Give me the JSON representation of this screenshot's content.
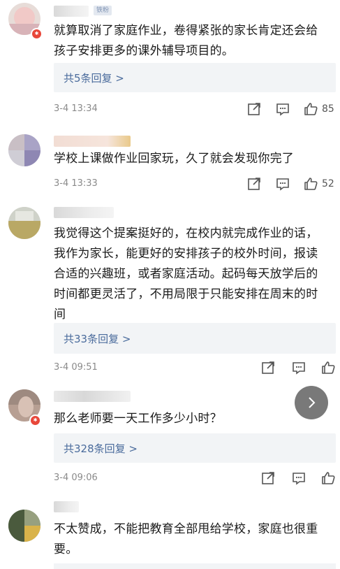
{
  "comments": [
    {
      "badge": "铁粉",
      "text": "就算取消了家庭作业，卷得紧张的家长肯定还会给孩子安排更多的课外辅导项目的。",
      "replies": "共5条回复 >",
      "time": "3-4 13:34",
      "likes": "85"
    },
    {
      "text": "学校上课做作业回家玩，久了就会发现你完了",
      "time": "3-4 13:33",
      "likes": "52"
    },
    {
      "text": "我觉得这个提案挺好的，在校内就完成作业的话，我作为家长，能更好的安排孩子的校外时间，报读合适的兴趣班，或者家庭活动。起码每天放学后的时间都更灵活了，不用局限于只能安排在周末的时间",
      "replies": "共33条回复 >",
      "time": "3-4 09:51"
    },
    {
      "text": "那么老师要一天工作多少小时？",
      "replies": "共328条回复 >",
      "time": "3-4 09:06"
    },
    {
      "text": "不太赞成，不能把教育全部甩给学校，家庭也很重要。"
    }
  ],
  "icons": {
    "share": "share-icon",
    "comment": "comment-icon",
    "like": "thumbs-up-icon",
    "next": "chevron-right-icon"
  },
  "colors": {
    "reply_link": "#4a6b9c",
    "reply_bg": "#f2f4f6",
    "timestamp": "#8a8a8a",
    "vip_badge": "#e8473a"
  }
}
